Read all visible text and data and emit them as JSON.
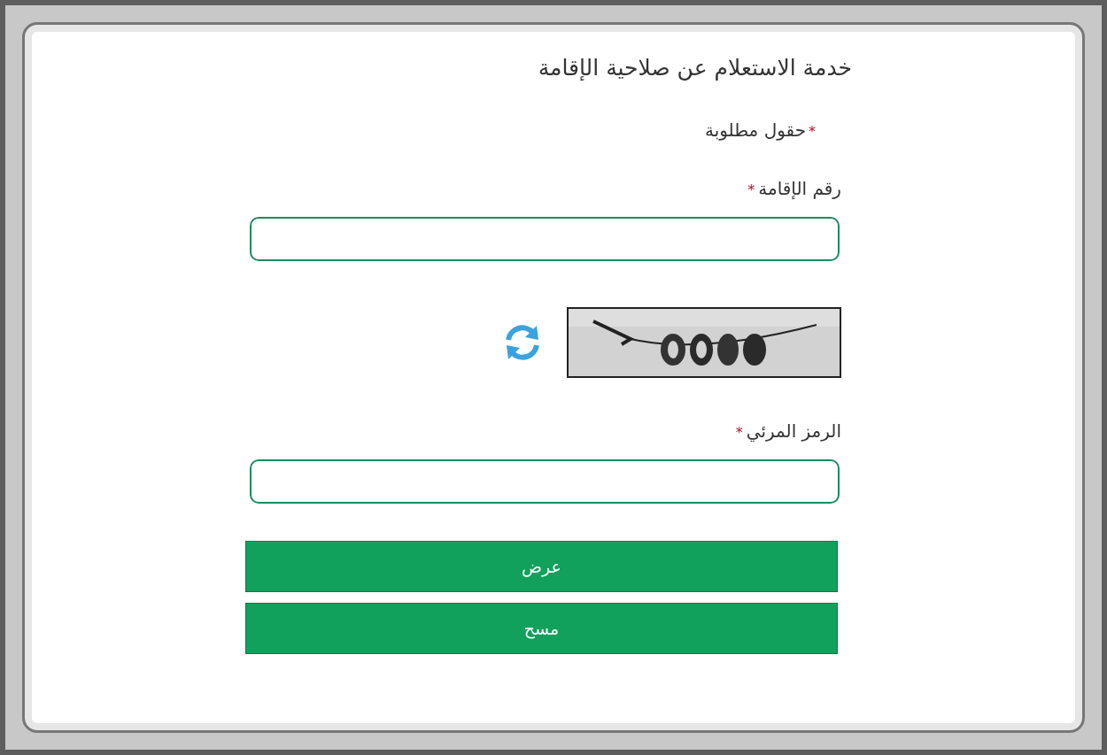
{
  "title": "خدمة الاستعلام عن صلاحية الإقامة",
  "required_note": {
    "mark": "*",
    "text": "حقول مطلوبة"
  },
  "fields": [
    {
      "kind": "text",
      "label": "رقم الإقامة",
      "mark": "*"
    },
    {
      "kind": "captcha"
    },
    {
      "kind": "text",
      "label": "الرمز المرئي",
      "mark": "*"
    }
  ],
  "buttons": [
    {
      "label": "عرض"
    },
    {
      "label": "مسح"
    }
  ]
}
